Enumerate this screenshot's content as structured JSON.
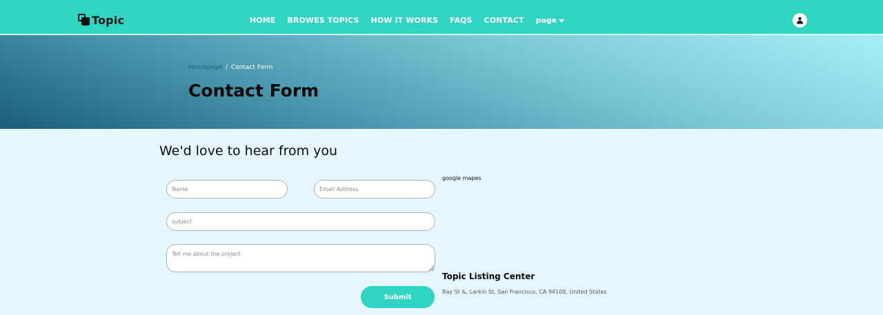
{
  "brand": {
    "name": "Topic"
  },
  "nav": {
    "links": [
      "HOME",
      "BROWES TOPICS",
      "HOW IT WORKS",
      "FAQS",
      "CONTACT"
    ],
    "dropdown_label": "page"
  },
  "hero": {
    "breadcrumb_home": "Homepage",
    "breadcrumb_separator": "/",
    "breadcrumb_current": "Contact Form",
    "title": "Contact Form"
  },
  "form": {
    "heading": "We'd love to hear from you",
    "name_placeholder": "Name",
    "email_placeholder": "Email Address",
    "subject_placeholder": "subject",
    "message_placeholder": "Tell me about the project",
    "submit_label": "Submit"
  },
  "map": {
    "label": "google mapes"
  },
  "location": {
    "title": "Topic Listing Center",
    "address": "Bay St &, Larkin St, San Francisco, CA 94109, United States"
  },
  "colors": {
    "accent": "#2fd4c2",
    "page_bg": "#e7f6fd",
    "hero_dark": "#1a5e78",
    "hero_light": "#a6f0f5"
  },
  "icons": {
    "brand": "stacked-squares-icon",
    "user": "user-icon",
    "caret": "caret-down-icon"
  }
}
